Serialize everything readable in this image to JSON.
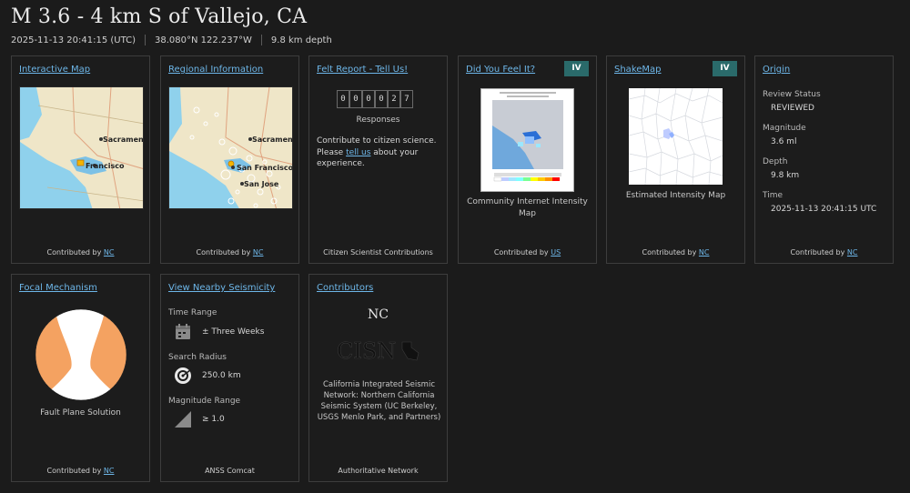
{
  "event": {
    "title": "M 3.6 - 4 km S of Vallejo, CA",
    "datetime": "2025-11-13 20:41:15 (UTC)",
    "coordinates": "38.080°N 122.237°W",
    "depth": "9.8 km depth"
  },
  "cards": {
    "interactive_map": {
      "title": "Interactive Map",
      "labels": {
        "sacramento": "Sacramento",
        "francisco": "Francisco"
      },
      "contributed_prefix": "Contributed by",
      "contributor": "NC"
    },
    "regional": {
      "title": "Regional Information",
      "labels": {
        "sacramento": "Sacramento",
        "san_francisco": "San Francisco",
        "san_jose": "San Jose"
      },
      "contributed_prefix": "Contributed by",
      "contributor": "NC"
    },
    "felt_report": {
      "title": "Felt Report - Tell Us!",
      "digits": [
        "0",
        "0",
        "0",
        "0",
        "2",
        "7"
      ],
      "responses_label": "Responses",
      "text_1": "Contribute to citizen science.",
      "text_2": "Please",
      "link": "tell us",
      "text_3": "about your",
      "text_4": "experience.",
      "footer": "Citizen Scientist Contributions"
    },
    "dyfi": {
      "title": "Did You Feel It?",
      "badge": "IV",
      "caption_1": "Community Internet Intensity",
      "caption_2": "Map",
      "contributed_prefix": "Contributed by",
      "contributor": "US"
    },
    "shakemap": {
      "title": "ShakeMap",
      "badge": "IV",
      "caption": "Estimated Intensity Map",
      "contributed_prefix": "Contributed by",
      "contributor": "NC"
    },
    "origin": {
      "title": "Origin",
      "review_status_label": "Review Status",
      "review_status": "REVIEWED",
      "magnitude_label": "Magnitude",
      "magnitude": "3.6 ml",
      "depth_label": "Depth",
      "depth": "9.8 km",
      "time_label": "Time",
      "time": "2025-11-13 20:41:15 UTC",
      "contributed_prefix": "Contributed by",
      "contributor": "NC"
    },
    "focal": {
      "title": "Focal Mechanism",
      "caption": "Fault Plane Solution",
      "contributed_prefix": "Contributed by",
      "contributor": "NC",
      "fill_color": "#f4a261"
    },
    "nearby": {
      "title": "View Nearby Seismicity",
      "time_range_label": "Time Range",
      "time_range": "± Three Weeks",
      "radius_label": "Search Radius",
      "radius": "250.0 km",
      "mag_range_label": "Magnitude Range",
      "mag_range": "≥ 1.0",
      "footer": "ANSS Comcat"
    },
    "contributors": {
      "title": "Contributors",
      "network": "NC",
      "cisn": "CISN",
      "desc_1": "California Integrated Seismic",
      "desc_2": "Network: Northern California",
      "desc_3": "Seismic System (UC Berkeley,",
      "desc_4": "USGS Menlo Park, and Partners)",
      "footer": "Authoritative Network"
    }
  }
}
